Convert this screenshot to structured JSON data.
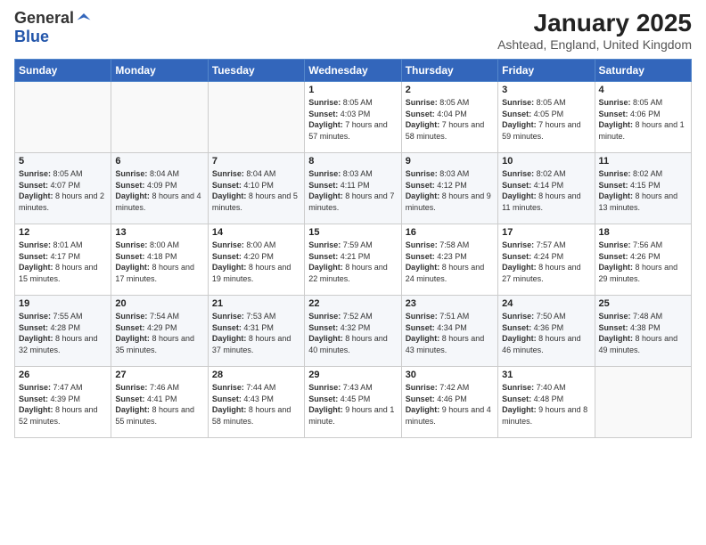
{
  "logo": {
    "general": "General",
    "blue": "Blue"
  },
  "header": {
    "month": "January 2025",
    "location": "Ashtead, England, United Kingdom"
  },
  "weekdays": [
    "Sunday",
    "Monday",
    "Tuesday",
    "Wednesday",
    "Thursday",
    "Friday",
    "Saturday"
  ],
  "weeks": [
    [
      {
        "day": "",
        "info": ""
      },
      {
        "day": "",
        "info": ""
      },
      {
        "day": "",
        "info": ""
      },
      {
        "day": "1",
        "info": "Sunrise: 8:05 AM\nSunset: 4:03 PM\nDaylight: 7 hours and 57 minutes."
      },
      {
        "day": "2",
        "info": "Sunrise: 8:05 AM\nSunset: 4:04 PM\nDaylight: 7 hours and 58 minutes."
      },
      {
        "day": "3",
        "info": "Sunrise: 8:05 AM\nSunset: 4:05 PM\nDaylight: 7 hours and 59 minutes."
      },
      {
        "day": "4",
        "info": "Sunrise: 8:05 AM\nSunset: 4:06 PM\nDaylight: 8 hours and 1 minute."
      }
    ],
    [
      {
        "day": "5",
        "info": "Sunrise: 8:05 AM\nSunset: 4:07 PM\nDaylight: 8 hours and 2 minutes."
      },
      {
        "day": "6",
        "info": "Sunrise: 8:04 AM\nSunset: 4:09 PM\nDaylight: 8 hours and 4 minutes."
      },
      {
        "day": "7",
        "info": "Sunrise: 8:04 AM\nSunset: 4:10 PM\nDaylight: 8 hours and 5 minutes."
      },
      {
        "day": "8",
        "info": "Sunrise: 8:03 AM\nSunset: 4:11 PM\nDaylight: 8 hours and 7 minutes."
      },
      {
        "day": "9",
        "info": "Sunrise: 8:03 AM\nSunset: 4:12 PM\nDaylight: 8 hours and 9 minutes."
      },
      {
        "day": "10",
        "info": "Sunrise: 8:02 AM\nSunset: 4:14 PM\nDaylight: 8 hours and 11 minutes."
      },
      {
        "day": "11",
        "info": "Sunrise: 8:02 AM\nSunset: 4:15 PM\nDaylight: 8 hours and 13 minutes."
      }
    ],
    [
      {
        "day": "12",
        "info": "Sunrise: 8:01 AM\nSunset: 4:17 PM\nDaylight: 8 hours and 15 minutes."
      },
      {
        "day": "13",
        "info": "Sunrise: 8:00 AM\nSunset: 4:18 PM\nDaylight: 8 hours and 17 minutes."
      },
      {
        "day": "14",
        "info": "Sunrise: 8:00 AM\nSunset: 4:20 PM\nDaylight: 8 hours and 19 minutes."
      },
      {
        "day": "15",
        "info": "Sunrise: 7:59 AM\nSunset: 4:21 PM\nDaylight: 8 hours and 22 minutes."
      },
      {
        "day": "16",
        "info": "Sunrise: 7:58 AM\nSunset: 4:23 PM\nDaylight: 8 hours and 24 minutes."
      },
      {
        "day": "17",
        "info": "Sunrise: 7:57 AM\nSunset: 4:24 PM\nDaylight: 8 hours and 27 minutes."
      },
      {
        "day": "18",
        "info": "Sunrise: 7:56 AM\nSunset: 4:26 PM\nDaylight: 8 hours and 29 minutes."
      }
    ],
    [
      {
        "day": "19",
        "info": "Sunrise: 7:55 AM\nSunset: 4:28 PM\nDaylight: 8 hours and 32 minutes."
      },
      {
        "day": "20",
        "info": "Sunrise: 7:54 AM\nSunset: 4:29 PM\nDaylight: 8 hours and 35 minutes."
      },
      {
        "day": "21",
        "info": "Sunrise: 7:53 AM\nSunset: 4:31 PM\nDaylight: 8 hours and 37 minutes."
      },
      {
        "day": "22",
        "info": "Sunrise: 7:52 AM\nSunset: 4:32 PM\nDaylight: 8 hours and 40 minutes."
      },
      {
        "day": "23",
        "info": "Sunrise: 7:51 AM\nSunset: 4:34 PM\nDaylight: 8 hours and 43 minutes."
      },
      {
        "day": "24",
        "info": "Sunrise: 7:50 AM\nSunset: 4:36 PM\nDaylight: 8 hours and 46 minutes."
      },
      {
        "day": "25",
        "info": "Sunrise: 7:48 AM\nSunset: 4:38 PM\nDaylight: 8 hours and 49 minutes."
      }
    ],
    [
      {
        "day": "26",
        "info": "Sunrise: 7:47 AM\nSunset: 4:39 PM\nDaylight: 8 hours and 52 minutes."
      },
      {
        "day": "27",
        "info": "Sunrise: 7:46 AM\nSunset: 4:41 PM\nDaylight: 8 hours and 55 minutes."
      },
      {
        "day": "28",
        "info": "Sunrise: 7:44 AM\nSunset: 4:43 PM\nDaylight: 8 hours and 58 minutes."
      },
      {
        "day": "29",
        "info": "Sunrise: 7:43 AM\nSunset: 4:45 PM\nDaylight: 9 hours and 1 minute."
      },
      {
        "day": "30",
        "info": "Sunrise: 7:42 AM\nSunset: 4:46 PM\nDaylight: 9 hours and 4 minutes."
      },
      {
        "day": "31",
        "info": "Sunrise: 7:40 AM\nSunset: 4:48 PM\nDaylight: 9 hours and 8 minutes."
      },
      {
        "day": "",
        "info": ""
      }
    ]
  ]
}
